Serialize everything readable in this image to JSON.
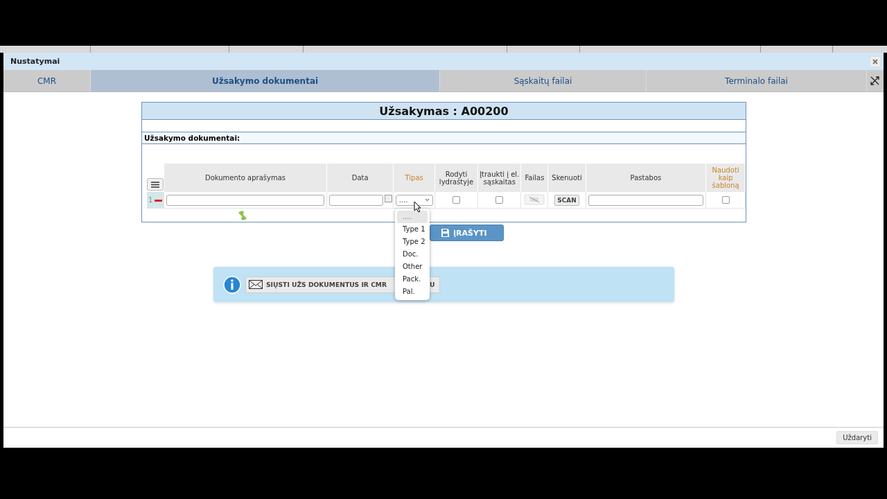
{
  "window": {
    "title": "Nustatymai"
  },
  "tabs": [
    {
      "label": "CMR",
      "selected": false
    },
    {
      "label": "Užsakymo dokumentai",
      "selected": true
    },
    {
      "label": "Sąskaitų failai",
      "selected": false
    },
    {
      "label": "Terminalo failai",
      "selected": false
    }
  ],
  "card": {
    "title": "Užsakymas : A00200",
    "section": "Užsakymo dokumentai:"
  },
  "table": {
    "columns": [
      {
        "label": "Dokumento aprašymas",
        "color": "#333333"
      },
      {
        "label": "Data",
        "color": "#333333"
      },
      {
        "label": "Tipas",
        "color": "#c8852e"
      },
      {
        "label": "Rodyti lydraštyje",
        "color": "#333333"
      },
      {
        "label": "Įtraukti į el. sąskaitas",
        "color": "#333333"
      },
      {
        "label": "Failas",
        "color": "#333333"
      },
      {
        "label": "Skenuoti",
        "color": "#333333"
      },
      {
        "label": "Pastabos",
        "color": "#333333"
      },
      {
        "label": "Naudoti kaip šabloną",
        "color": "#c8852e"
      }
    ],
    "rows": [
      {
        "number": "1",
        "type": "....",
        "show_in_waybill": false,
        "include_in_invoice": false,
        "scan_button": "SCAN",
        "use_as_template": false
      }
    ]
  },
  "type_dropdown": {
    "options": [
      {
        "label": "....",
        "selected": true
      },
      {
        "label": "Type 1",
        "selected": false
      },
      {
        "label": "Type 2",
        "selected": false
      },
      {
        "label": "Doc.",
        "selected": false
      },
      {
        "label": "Other",
        "selected": false
      },
      {
        "label": "Pack.",
        "selected": false
      },
      {
        "label": "Pal.",
        "selected": false
      }
    ]
  },
  "save_button": "ĮRAŠYTI",
  "info": {
    "send_button_visible": "SIŲSTI UŽS DOKUMENTUS IR CMR",
    "send_button_tail": "U"
  },
  "footer": {
    "close_button": "Uždaryti"
  }
}
